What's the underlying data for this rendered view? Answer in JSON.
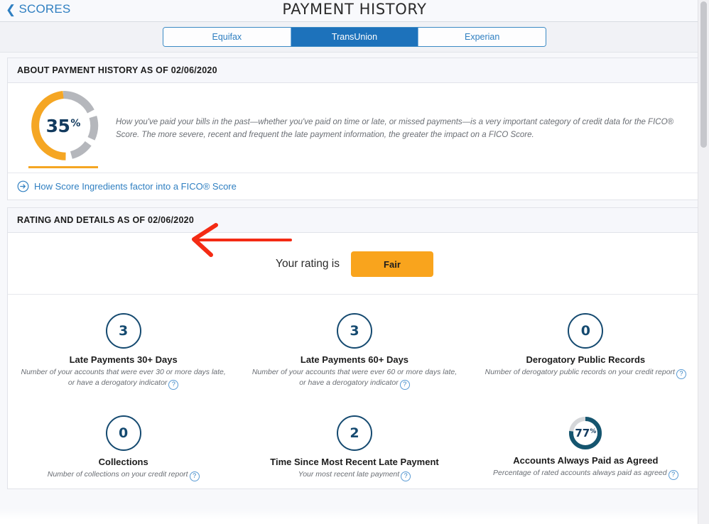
{
  "header": {
    "back_label": "SCORES",
    "back_icon": "chevron-left-icon",
    "title": "PAYMENT HISTORY"
  },
  "bureau_tabs": {
    "items": [
      {
        "label": "Equifax",
        "active": false
      },
      {
        "label": "TransUnion",
        "active": true
      },
      {
        "label": "Experian",
        "active": false
      }
    ],
    "active_label": "TransUnion",
    "accent_color": "#1d72bb"
  },
  "about_section": {
    "heading": "ABOUT PAYMENT HISTORY AS OF 02/06/2020",
    "donut": {
      "value": "35",
      "unit": "%",
      "percent": 35,
      "arc_color": "#f5a623",
      "track_color": "#b5b7bc",
      "label_color": "#123a5e"
    },
    "description": "How you've paid your bills in the past—whether you've paid on time or late, or missed payments—is a very important category of credit data for the FICO® Score. The more severe, recent and frequent the late payment information, the greater the impact on a FICO Score.",
    "link": {
      "icon": "arrow-right-circle-icon",
      "text": "How Score Ingredients factor into a FICO® Score"
    }
  },
  "rating_section": {
    "heading": "RATING AND DETAILS AS OF 02/06/2020",
    "rating_label": "Your rating is",
    "rating_value": "Fair",
    "rating_color": "#f9a41d",
    "metrics": [
      {
        "value": "3",
        "title": "Late Payments 30+ Days",
        "description": "Number of your accounts that were ever 30 or more days late, or have a derogatory indicator",
        "help_icon": "question-mark-icon",
        "type": "circle"
      },
      {
        "value": "3",
        "title": "Late Payments 60+ Days",
        "description": "Number of your accounts that were ever 60 or more days late, or have a derogatory indicator",
        "help_icon": "question-mark-icon",
        "type": "circle"
      },
      {
        "value": "0",
        "title": "Derogatory Public Records",
        "description": "Number of derogatory public records on your credit report",
        "help_icon": "question-mark-icon",
        "type": "circle"
      },
      {
        "value": "0",
        "title": "Collections",
        "description": "Number of collections on your credit report",
        "help_icon": "question-mark-icon",
        "type": "circle"
      },
      {
        "value": "2",
        "title": "Time Since Most Recent Late Payment",
        "description": "Your most recent late payment",
        "help_icon": "question-mark-icon",
        "type": "circle"
      },
      {
        "value": "77",
        "unit": "%",
        "percent": 77,
        "title": "Accounts Always Paid as Agreed",
        "description": "Percentage of rated accounts always paid as agreed",
        "help_icon": "question-mark-icon",
        "type": "ring",
        "ring_color": "#15556f",
        "ring_track_color": "#d5d7da"
      }
    ]
  },
  "annotation": {
    "shape": "arrow-left",
    "color": "#f42b14"
  }
}
